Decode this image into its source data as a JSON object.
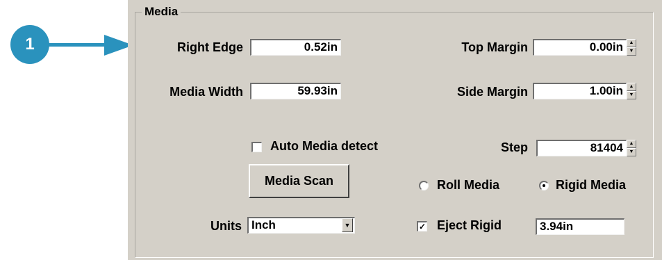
{
  "callout": {
    "number": "1"
  },
  "group": {
    "title": "Media"
  },
  "right_edge": {
    "label": "Right Edge",
    "value": "0.52in"
  },
  "media_width": {
    "label": "Media Width",
    "value": "59.93in"
  },
  "top_margin": {
    "label": "Top Margin",
    "value": "0.00in"
  },
  "side_margin": {
    "label": "Side Margin",
    "value": "1.00in"
  },
  "auto_media": {
    "label": "Auto Media detect",
    "checked": false
  },
  "step": {
    "label": "Step",
    "value": "81404"
  },
  "media_scan": {
    "label": "Media Scan"
  },
  "roll_media": {
    "label": "Roll Media",
    "selected": false
  },
  "rigid_media": {
    "label": "Rigid Media",
    "selected": true
  },
  "units": {
    "label": "Units",
    "value": "Inch"
  },
  "eject_rigid": {
    "label": "Eject Rigid",
    "checked": true,
    "value": "3.94in"
  },
  "icons": {
    "spin_up": "spin-up-arrow-icon",
    "spin_down": "spin-down-arrow-icon",
    "dropdown": "dropdown-arrow-icon",
    "checkmark": "checkmark-icon"
  },
  "colors": {
    "callout": "#2a92bd",
    "panel": "#d4d0c8"
  }
}
